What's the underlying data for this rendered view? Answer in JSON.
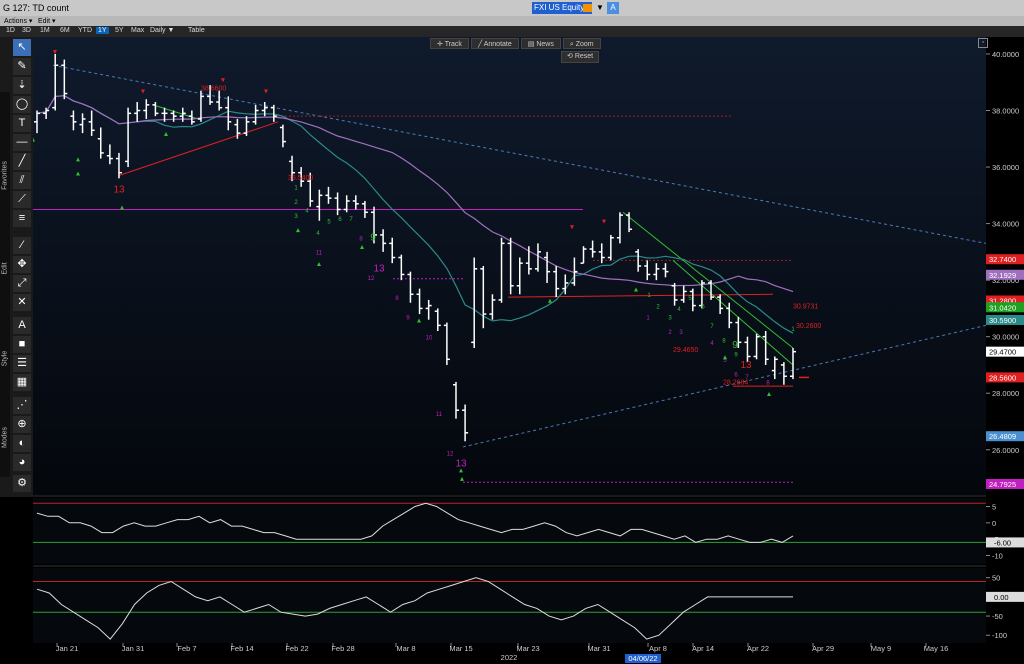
{
  "window": {
    "title": "G 127: TD count"
  },
  "security": {
    "ticker": "FXI US Equity",
    "dropdown": "▼",
    "assist": "A"
  },
  "menu": {
    "actions": "Actions ▾",
    "edit": "Edit ▾"
  },
  "ranges": [
    {
      "label": "1D",
      "selected": false
    },
    {
      "label": "3D",
      "selected": false
    },
    {
      "label": "1M",
      "selected": false
    },
    {
      "label": "6M",
      "selected": false
    },
    {
      "label": "YTD",
      "selected": false
    },
    {
      "label": "1Y",
      "selected": true
    },
    {
      "label": "5Y",
      "selected": false
    },
    {
      "label": "Max",
      "selected": false
    },
    {
      "label": "Daily ▼",
      "selected": false
    },
    {
      "label": "Table",
      "selected": false
    }
  ],
  "controls": {
    "track": "Track",
    "annotate": "Annotate",
    "news": "News",
    "zoom": "Zoom",
    "reset": "Reset"
  },
  "toolbar": {
    "sections": {
      "favorites": "Favorites",
      "edit": "Edit",
      "style": "Style",
      "modes": "Modes"
    },
    "tools": [
      "cursor-icon",
      "pen-icon",
      "arrow-down-icon",
      "ellipse-icon",
      "text-icon",
      "hline-icon",
      "line-icon",
      "channel-icon",
      "path-icon",
      "fib-icon",
      "brush-icon",
      "move-icon",
      "zoom-icon",
      "delete-icon",
      "font-icon",
      "color-icon",
      "linestyle-icon",
      "fill-icon",
      "dotted-icon",
      "crosshair-icon",
      "magnet-icon",
      "palette-icon",
      "settings-icon"
    ]
  },
  "colors": {
    "background": "#0a0f18",
    "price": "#ffffff",
    "ma_teal": "#2a8a8a",
    "ma_purple": "#a070c0",
    "red": "#e03030",
    "green": "#30c030",
    "magenta": "#c020c0",
    "osc_line": "#dddddd"
  },
  "chart_data": {
    "type": "ohlc",
    "date_axis": {
      "labels": [
        "Jan 21",
        "Jan 31",
        "Feb 7",
        "Feb 14",
        "Feb 22",
        "Feb 28",
        "Mar 8",
        "Mar 15",
        "Mar 23",
        "Mar 31",
        "Apr 8",
        "Apr 14",
        "Apr 22",
        "Apr 29",
        "May 9",
        "May 16"
      ],
      "year": "2022",
      "highlight": "04/06/22"
    },
    "price_axis": {
      "ticks": [
        "40.0000",
        "38.0000",
        "36.0000",
        "34.0000",
        "32.0000",
        "30.0000",
        "28.0000",
        "26.0000"
      ],
      "ylim": [
        24.4,
        40.6
      ]
    },
    "badges": [
      {
        "label": "32.7400",
        "value": 32.74,
        "color": "#e02020"
      },
      {
        "label": "32.1929",
        "value": 32.19,
        "color": "#a070c0"
      },
      {
        "label": "31.2800",
        "value": 31.28,
        "color": "#e02020"
      },
      {
        "label": "31.0420",
        "value": 31.04,
        "color": "#20a020"
      },
      {
        "label": "30.5900",
        "value": 30.59,
        "color": "#2a8a8a"
      },
      {
        "label": "29.4700",
        "value": 29.47,
        "color": "#ffffff"
      },
      {
        "label": "28.5600",
        "value": 28.56,
        "color": "#e02020"
      },
      {
        "label": "26.4809",
        "value": 26.48,
        "color": "#4a90d0"
      },
      {
        "label": "24.7925",
        "value": 24.79,
        "color": "#c020c0"
      }
    ],
    "price_levels": [
      {
        "label": "38.6600",
        "value": 38.66
      },
      {
        "label": "35.5400",
        "value": 35.54
      },
      {
        "label": "29.4650",
        "value": 29.465
      },
      {
        "label": "30.9731",
        "value": 30.9731
      },
      {
        "label": "30.2600",
        "value": 30.26
      },
      {
        "label": "28.2684",
        "value": 28.2684
      }
    ],
    "bars": [
      {
        "o": 37.6,
        "h": 38.0,
        "l": 37.2,
        "c": 37.9
      },
      {
        "o": 37.9,
        "h": 38.1,
        "l": 37.7,
        "c": 38.0
      },
      {
        "o": 38.1,
        "h": 40.0,
        "l": 38.0,
        "c": 39.6
      },
      {
        "o": 39.6,
        "h": 39.8,
        "l": 38.4,
        "c": 38.6
      },
      {
        "o": 37.8,
        "h": 38.0,
        "l": 37.3,
        "c": 37.6
      },
      {
        "o": 37.5,
        "h": 37.9,
        "l": 37.2,
        "c": 37.7
      },
      {
        "o": 37.6,
        "h": 38.0,
        "l": 37.1,
        "c": 37.3
      },
      {
        "o": 37.0,
        "h": 37.4,
        "l": 36.3,
        "c": 36.5
      },
      {
        "o": 36.4,
        "h": 36.8,
        "l": 36.1,
        "c": 36.3
      },
      {
        "o": 36.3,
        "h": 36.5,
        "l": 35.6,
        "c": 35.8
      },
      {
        "o": 36.2,
        "h": 38.1,
        "l": 36.0,
        "c": 37.9
      },
      {
        "o": 37.9,
        "h": 38.3,
        "l": 37.6,
        "c": 38.0
      },
      {
        "o": 38.0,
        "h": 38.4,
        "l": 37.7,
        "c": 38.2
      },
      {
        "o": 38.2,
        "h": 38.3,
        "l": 37.8,
        "c": 37.9
      },
      {
        "o": 37.9,
        "h": 38.1,
        "l": 37.6,
        "c": 37.9
      },
      {
        "o": 37.9,
        "h": 38.0,
        "l": 37.6,
        "c": 37.8
      },
      {
        "o": 37.8,
        "h": 38.1,
        "l": 37.6,
        "c": 37.9
      },
      {
        "o": 37.8,
        "h": 38.0,
        "l": 37.5,
        "c": 37.6
      },
      {
        "o": 37.7,
        "h": 38.7,
        "l": 37.6,
        "c": 38.5
      },
      {
        "o": 38.5,
        "h": 38.9,
        "l": 38.2,
        "c": 38.3
      },
      {
        "o": 38.3,
        "h": 38.7,
        "l": 38.0,
        "c": 38.1
      },
      {
        "o": 38.1,
        "h": 38.5,
        "l": 37.3,
        "c": 37.6
      },
      {
        "o": 37.5,
        "h": 37.7,
        "l": 37.0,
        "c": 37.2
      },
      {
        "o": 37.2,
        "h": 37.8,
        "l": 37.1,
        "c": 37.6
      },
      {
        "o": 37.6,
        "h": 38.2,
        "l": 37.5,
        "c": 38.0
      },
      {
        "o": 38.0,
        "h": 38.3,
        "l": 37.8,
        "c": 38.1
      },
      {
        "o": 38.1,
        "h": 38.2,
        "l": 37.6,
        "c": 37.8
      },
      {
        "o": 37.4,
        "h": 37.5,
        "l": 36.7,
        "c": 36.9
      },
      {
        "o": 36.2,
        "h": 36.4,
        "l": 35.5,
        "c": 35.8
      },
      {
        "o": 35.8,
        "h": 36.0,
        "l": 35.3,
        "c": 35.5
      },
      {
        "o": 35.5,
        "h": 35.8,
        "l": 34.6,
        "c": 34.8
      },
      {
        "o": 34.6,
        "h": 35.2,
        "l": 34.1,
        "c": 35.0
      },
      {
        "o": 35.0,
        "h": 35.3,
        "l": 34.7,
        "c": 34.9
      },
      {
        "o": 34.9,
        "h": 35.1,
        "l": 34.3,
        "c": 34.5
      },
      {
        "o": 34.5,
        "h": 35.0,
        "l": 34.4,
        "c": 34.8
      },
      {
        "o": 34.8,
        "h": 35.0,
        "l": 34.5,
        "c": 34.7
      },
      {
        "o": 34.7,
        "h": 34.8,
        "l": 34.2,
        "c": 34.4
      },
      {
        "o": 34.4,
        "h": 34.6,
        "l": 33.3,
        "c": 33.6
      },
      {
        "o": 33.6,
        "h": 33.8,
        "l": 33.0,
        "c": 33.3
      },
      {
        "o": 33.3,
        "h": 33.5,
        "l": 32.6,
        "c": 32.8
      },
      {
        "o": 32.8,
        "h": 32.9,
        "l": 32.0,
        "c": 32.2
      },
      {
        "o": 32.2,
        "h": 32.3,
        "l": 31.2,
        "c": 31.5
      },
      {
        "o": 31.5,
        "h": 31.7,
        "l": 30.8,
        "c": 31.0
      },
      {
        "o": 31.0,
        "h": 31.3,
        "l": 30.6,
        "c": 31.1
      },
      {
        "o": 30.9,
        "h": 31.0,
        "l": 30.2,
        "c": 30.4
      },
      {
        "o": 30.4,
        "h": 30.5,
        "l": 29.0,
        "c": 29.2
      },
      {
        "o": 28.3,
        "h": 28.4,
        "l": 27.1,
        "c": 27.4
      },
      {
        "o": 27.4,
        "h": 27.6,
        "l": 26.3,
        "c": 26.6
      },
      {
        "o": 29.8,
        "h": 32.8,
        "l": 29.6,
        "c": 32.4
      },
      {
        "o": 32.4,
        "h": 32.5,
        "l": 30.3,
        "c": 30.8
      },
      {
        "o": 30.8,
        "h": 31.5,
        "l": 30.6,
        "c": 31.3
      },
      {
        "o": 31.3,
        "h": 33.5,
        "l": 31.2,
        "c": 33.3
      },
      {
        "o": 33.3,
        "h": 33.5,
        "l": 31.5,
        "c": 31.8
      },
      {
        "o": 31.8,
        "h": 32.8,
        "l": 31.5,
        "c": 32.6
      },
      {
        "o": 32.6,
        "h": 33.2,
        "l": 32.2,
        "c": 32.4
      },
      {
        "o": 32.4,
        "h": 33.3,
        "l": 32.3,
        "c": 33.0
      },
      {
        "o": 32.8,
        "h": 33.0,
        "l": 31.9,
        "c": 32.3
      },
      {
        "o": 32.3,
        "h": 32.5,
        "l": 31.4,
        "c": 31.7
      },
      {
        "o": 31.7,
        "h": 32.2,
        "l": 31.5,
        "c": 31.9
      },
      {
        "o": 31.9,
        "h": 32.8,
        "l": 31.8,
        "c": 32.3
      },
      {
        "o": 32.6,
        "h": 33.2,
        "l": 32.6,
        "c": 33.1
      },
      {
        "o": 33.1,
        "h": 33.4,
        "l": 32.8,
        "c": 33.0
      },
      {
        "o": 33.0,
        "h": 33.3,
        "l": 32.6,
        "c": 32.8
      },
      {
        "o": 32.8,
        "h": 33.6,
        "l": 32.7,
        "c": 33.5
      },
      {
        "o": 33.5,
        "h": 34.4,
        "l": 33.3,
        "c": 34.3
      },
      {
        "o": 34.3,
        "h": 34.4,
        "l": 33.7,
        "c": 33.8
      },
      {
        "o": 33.0,
        "h": 33.1,
        "l": 32.3,
        "c": 32.5
      },
      {
        "o": 32.5,
        "h": 32.7,
        "l": 32.0,
        "c": 32.2
      },
      {
        "o": 32.2,
        "h": 32.6,
        "l": 32.0,
        "c": 32.4
      },
      {
        "o": 32.4,
        "h": 32.6,
        "l": 32.1,
        "c": 32.3
      },
      {
        "o": 31.8,
        "h": 31.9,
        "l": 31.1,
        "c": 31.3
      },
      {
        "o": 31.3,
        "h": 31.8,
        "l": 31.2,
        "c": 31.6
      },
      {
        "o": 31.6,
        "h": 31.7,
        "l": 30.9,
        "c": 31.1
      },
      {
        "o": 31.1,
        "h": 32.0,
        "l": 31.0,
        "c": 31.9
      },
      {
        "o": 31.9,
        "h": 32.0,
        "l": 31.3,
        "c": 31.4
      },
      {
        "o": 31.4,
        "h": 31.5,
        "l": 30.8,
        "c": 31.0
      },
      {
        "o": 31.0,
        "h": 31.2,
        "l": 30.3,
        "c": 30.5
      },
      {
        "o": 30.5,
        "h": 30.7,
        "l": 29.6,
        "c": 29.8
      },
      {
        "o": 29.8,
        "h": 30.0,
        "l": 29.1,
        "c": 29.3
      },
      {
        "o": 29.3,
        "h": 30.1,
        "l": 29.2,
        "c": 30.0
      },
      {
        "o": 30.0,
        "h": 30.2,
        "l": 29.0,
        "c": 29.2
      },
      {
        "o": 28.8,
        "h": 29.3,
        "l": 28.5,
        "c": 29.2
      },
      {
        "o": 29.0,
        "h": 29.1,
        "l": 28.3,
        "c": 28.6
      },
      {
        "o": 28.6,
        "h": 29.6,
        "l": 28.5,
        "c": 29.47
      }
    ],
    "oscillator_1": {
      "ticks": [
        "5",
        "0",
        "-5",
        "-10"
      ],
      "ylim": [
        -12,
        7
      ],
      "level": "-6.00",
      "values": [
        3,
        2,
        2,
        0,
        0,
        -1,
        -3,
        -3,
        -1,
        0,
        -1,
        -1,
        0,
        1,
        1,
        2,
        0,
        1,
        -1,
        -1,
        -2,
        -3,
        -3,
        -4,
        -5,
        -5,
        -5,
        -5,
        -5,
        -5,
        -5,
        -4,
        -1,
        1,
        3,
        5,
        6,
        5,
        3,
        1,
        0,
        -1,
        -2,
        -3,
        -2,
        -2,
        -1,
        0,
        -1,
        -3,
        -4,
        -3,
        -2,
        -3,
        -4,
        -2,
        -2,
        -3,
        -4,
        -5,
        -4,
        -6,
        -5,
        -5,
        -4,
        -5,
        -6,
        -6,
        -5,
        -6,
        -4
      ]
    },
    "oscillator_2": {
      "ticks": [
        "50",
        "0",
        "-50",
        "-100"
      ],
      "ylim": [
        -115,
        70
      ],
      "level": "0.00",
      "values": [
        20,
        10,
        -20,
        -40,
        -60,
        -80,
        -110,
        -70,
        -20,
        10,
        30,
        40,
        20,
        0,
        -10,
        0,
        -20,
        -40,
        -30,
        -20,
        -40,
        -45,
        -50,
        -45,
        -30,
        -20,
        -10,
        0,
        -20,
        -40,
        -20,
        -10,
        10,
        20,
        30,
        40,
        50,
        40,
        20,
        0,
        -20,
        -30,
        -50,
        -60,
        -50,
        -30,
        -20,
        -40,
        -60,
        -80,
        -110,
        -100,
        -70,
        -40,
        -20,
        0,
        0,
        0,
        0,
        0,
        0,
        0,
        0
      ]
    }
  }
}
